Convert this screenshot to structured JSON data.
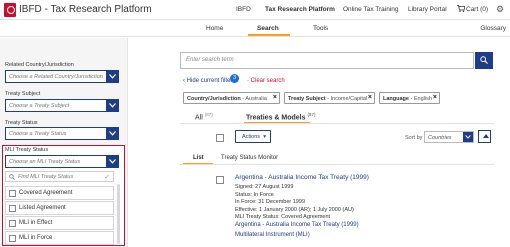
{
  "header": {
    "app_title": "IBFD - Tax Research Platform",
    "nav": [
      "IBFD",
      "Tax Research Platform",
      "Online Tax Training",
      "Library Portal"
    ],
    "cart_label": "Cart (0)"
  },
  "subnav": {
    "items": [
      "Home",
      "Search",
      "Tools"
    ],
    "glossary": "Glossary"
  },
  "sidebar": {
    "related_country_label": "Related Country/Jurisdiction",
    "related_country_placeholder": "Choose a Related Country/Jurisdiction",
    "treaty_subject_label": "Treaty Subject",
    "treaty_subject_placeholder": "Choose a Treaty Subject",
    "treaty_status_label": "Treaty Status",
    "treaty_status_placeholder": "Choose a Treaty Status",
    "mli_status_label": "MLI Treaty Status",
    "mli_status_placeholder": "Choose an MLI Treaty Status",
    "mli_search_placeholder": "Find MLI Treaty Status",
    "mli_options": [
      "Covered Agreement",
      "Listed Agreement",
      "MLI in Effect",
      "MLI in Force"
    ]
  },
  "search": {
    "placeholder": "Enter search term",
    "hide_filters": "Hide current filters",
    "filter_count": "3",
    "clear_search": "Clear search"
  },
  "chips": [
    {
      "label": "Country/Jurisdiction",
      "value": "Australia"
    },
    {
      "label": "Treaty Subject",
      "value": "Income/Capital"
    },
    {
      "label": "Language",
      "value": "English"
    }
  ],
  "tabs": [
    {
      "label": "All",
      "count": "(87)"
    },
    {
      "label": "Treaties & Models",
      "count": "(87)"
    }
  ],
  "toolbar": {
    "actions": "Actions",
    "sort_by": "Sort by",
    "sort_value": "Countries"
  },
  "views": [
    "List",
    "Treaty Status Monitor"
  ],
  "result": {
    "title": "Argentina - Australia Income Tax Treaty (1999)",
    "signed": "Signed: 27 August 1999",
    "status": "Status: In Force",
    "in_force": "In Force: 31 December 1999",
    "effective": "Effective: 1 January 2000 (AR); 1 July 2000 (AU)",
    "mli_status": "MLI Treaty Status: Covered Agreement",
    "link1": "Argentina - Australia Income Tax Treaty (1999)",
    "link2": "Multilateral Instrument (MLI)"
  },
  "colors": {
    "brand_red": "#c8102e",
    "primary_blue": "#1f3c88",
    "accent_orange": "#ff9c1a"
  }
}
